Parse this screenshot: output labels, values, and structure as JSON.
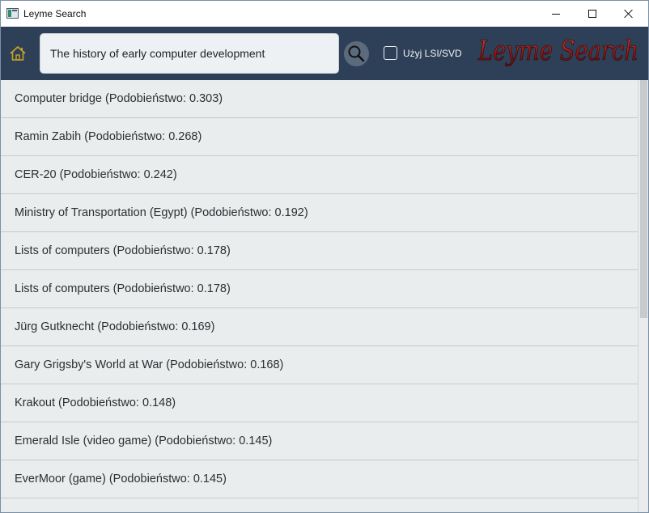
{
  "window": {
    "title": "Leyme Search",
    "controls": {
      "minimize": "minimize-icon",
      "maximize": "maximize-icon",
      "close": "close-icon"
    }
  },
  "toolbar": {
    "home_icon": "home-icon",
    "search": {
      "value": "The history of early computer development",
      "icon": "search-icon"
    },
    "lsi_checkbox": {
      "label": "Użyj LSI/SVD",
      "checked": false
    },
    "logo_text": "Leyme Search"
  },
  "colors": {
    "toolbar_bg": "#2e4057",
    "list_bg": "#eaeded",
    "logo": "#8b1a1a"
  },
  "results": [
    {
      "text": "Computer bridge (Podobieństwo: 0.303)"
    },
    {
      "text": "Ramin Zabih (Podobieństwo: 0.268)"
    },
    {
      "text": "CER-20 (Podobieństwo: 0.242)"
    },
    {
      "text": "Ministry of Transportation (Egypt) (Podobieństwo: 0.192)"
    },
    {
      "text": "Lists of computers (Podobieństwo: 0.178)"
    },
    {
      "text": "Lists of computers (Podobieństwo: 0.178)"
    },
    {
      "text": "Jürg Gutknecht (Podobieństwo: 0.169)"
    },
    {
      "text": "Gary Grigsby's World at War (Podobieństwo: 0.168)"
    },
    {
      "text": "Krakout (Podobieństwo: 0.148)"
    },
    {
      "text": "Emerald Isle (video game) (Podobieństwo: 0.145)"
    },
    {
      "text": "EverMoor (game) (Podobieństwo: 0.145)"
    },
    {
      "text": ""
    }
  ]
}
